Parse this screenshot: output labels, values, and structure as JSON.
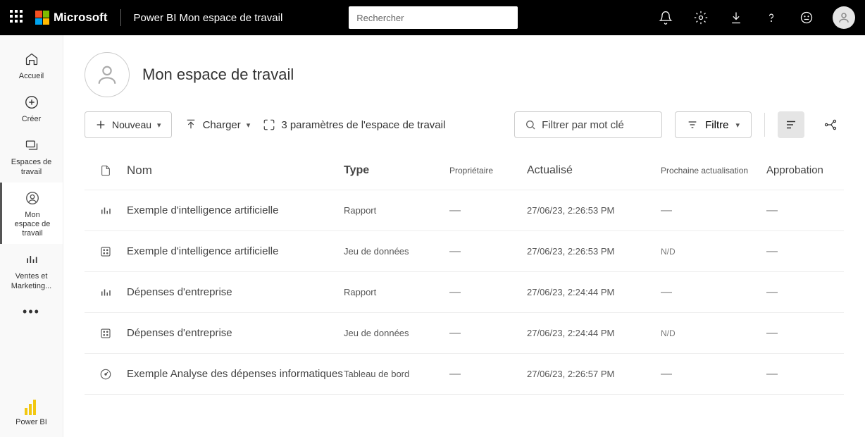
{
  "header": {
    "brand": "Microsoft",
    "breadcrumb": "Power BI Mon espace de travail",
    "search_placeholder": "Rechercher"
  },
  "rail": {
    "home": "Accueil",
    "create": "Créer",
    "workspaces": "Espaces de travail",
    "my_workspace_line1": "Mon",
    "my_workspace_line2": "espace de travail",
    "sales_line1": "Ventes et",
    "sales_line2": "Marketing...",
    "powerbi": "Power BI"
  },
  "workspace": {
    "title": "Mon espace de travail",
    "btn_new": "Nouveau",
    "btn_upload": "Charger",
    "settings": "3 paramètres de l'espace de travail",
    "filter_placeholder": "Filtrer par mot clé",
    "filter_label": "Filtre"
  },
  "columns": {
    "name": "Nom",
    "type": "Type",
    "owner": "Propriétaire",
    "refreshed": "Actualisé",
    "next": "Prochaine actualisation",
    "endorse": "Approbation"
  },
  "rows": [
    {
      "icon": "report",
      "name": "Exemple d'intelligence artificielle",
      "type": "Rapport",
      "owner": "—",
      "refreshed": "27/06/23, 2:26:53 PM",
      "next": "—",
      "endorse": "—"
    },
    {
      "icon": "dataset",
      "name": "Exemple  d'intelligence  artificielle",
      "type": "Jeu de données",
      "owner": "—",
      "refreshed": "27/06/23, 2:26:53 PM",
      "next": "N/D",
      "endorse": "—"
    },
    {
      "icon": "report",
      "name": "Dépenses d'entreprise",
      "type": "Rapport",
      "owner": "—",
      "refreshed": "27/06/23, 2:24:44 PM",
      "next": "—",
      "endorse": "—"
    },
    {
      "icon": "dataset",
      "name": "Dépenses d'entreprise",
      "type": "Jeu de données",
      "owner": "—",
      "refreshed": "27/06/23, 2:24:44 PM",
      "next": "N/D",
      "endorse": "—"
    },
    {
      "icon": "dashboard",
      "name": "Exemple Analyse des dépenses informatiques",
      "type": "Tableau de bord",
      "owner": "—",
      "refreshed": "27/06/23, 2:26:57 PM",
      "next": "—",
      "endorse": "—"
    }
  ]
}
